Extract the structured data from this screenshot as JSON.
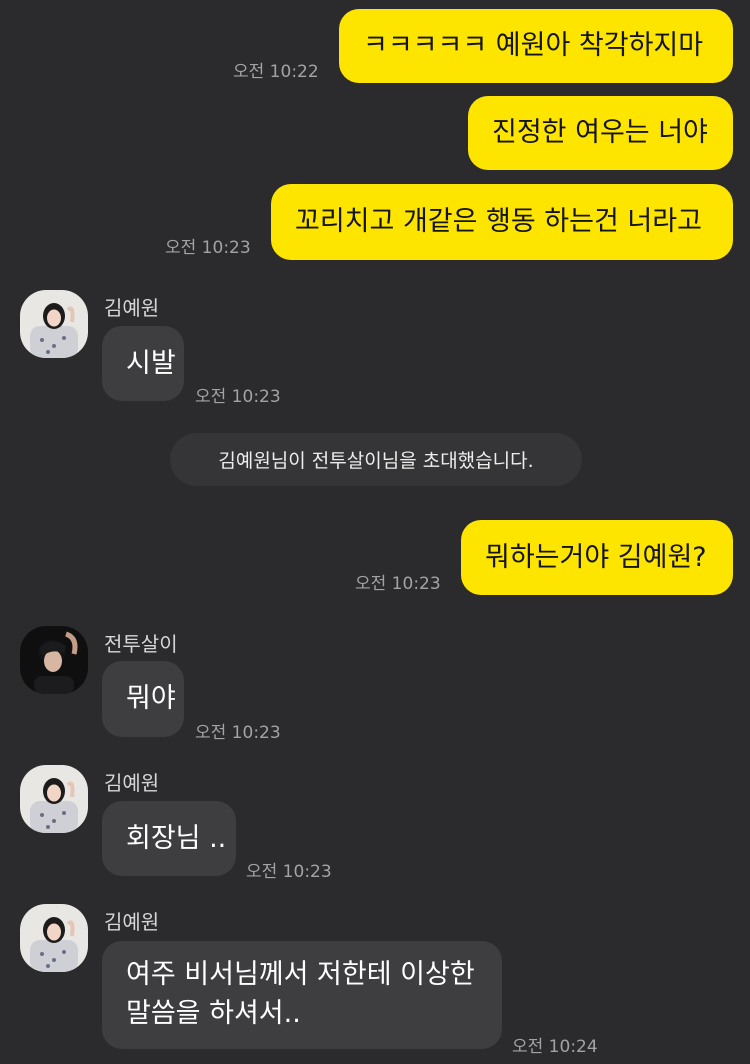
{
  "messages": [
    {
      "side": "out",
      "text": "ㅋㅋㅋㅋㅋ 예원아 착각하지마",
      "time": "오전 10:22"
    },
    {
      "side": "out",
      "text": "진정한 여우는 너야",
      "time": ""
    },
    {
      "side": "out",
      "text": "꼬리치고 개같은 행동 하는건 너라고",
      "time": "오전 10:23"
    },
    {
      "side": "in",
      "sender": "김예원",
      "text": "시발",
      "time": "오전 10:23"
    },
    {
      "side": "system",
      "text": "김예원님이 전투살이님을 초대했습니다."
    },
    {
      "side": "out",
      "text": "뭐하는거야 김예원?",
      "time": "오전 10:23"
    },
    {
      "side": "in",
      "sender": "전투살이",
      "text": "뭐야",
      "time": "오전 10:23"
    },
    {
      "side": "in",
      "sender": "김예원",
      "text": "회장님 ..",
      "time": "오전 10:23"
    },
    {
      "side": "in",
      "sender": "김예원",
      "text": "여주 비서님께서 저한테 이상한 말씀을 하셔서..",
      "time": "오전 10:24"
    }
  ],
  "colors": {
    "background": "#2b2b2d",
    "outgoing_bubble": "#fee500",
    "incoming_bubble": "#3e3e41",
    "system_bubble": "#353538",
    "time_text": "#a3a3a6"
  },
  "avatars": {
    "kim_yewon": "girl-photo-avatar",
    "jeontusari": "boy-photo-avatar"
  }
}
